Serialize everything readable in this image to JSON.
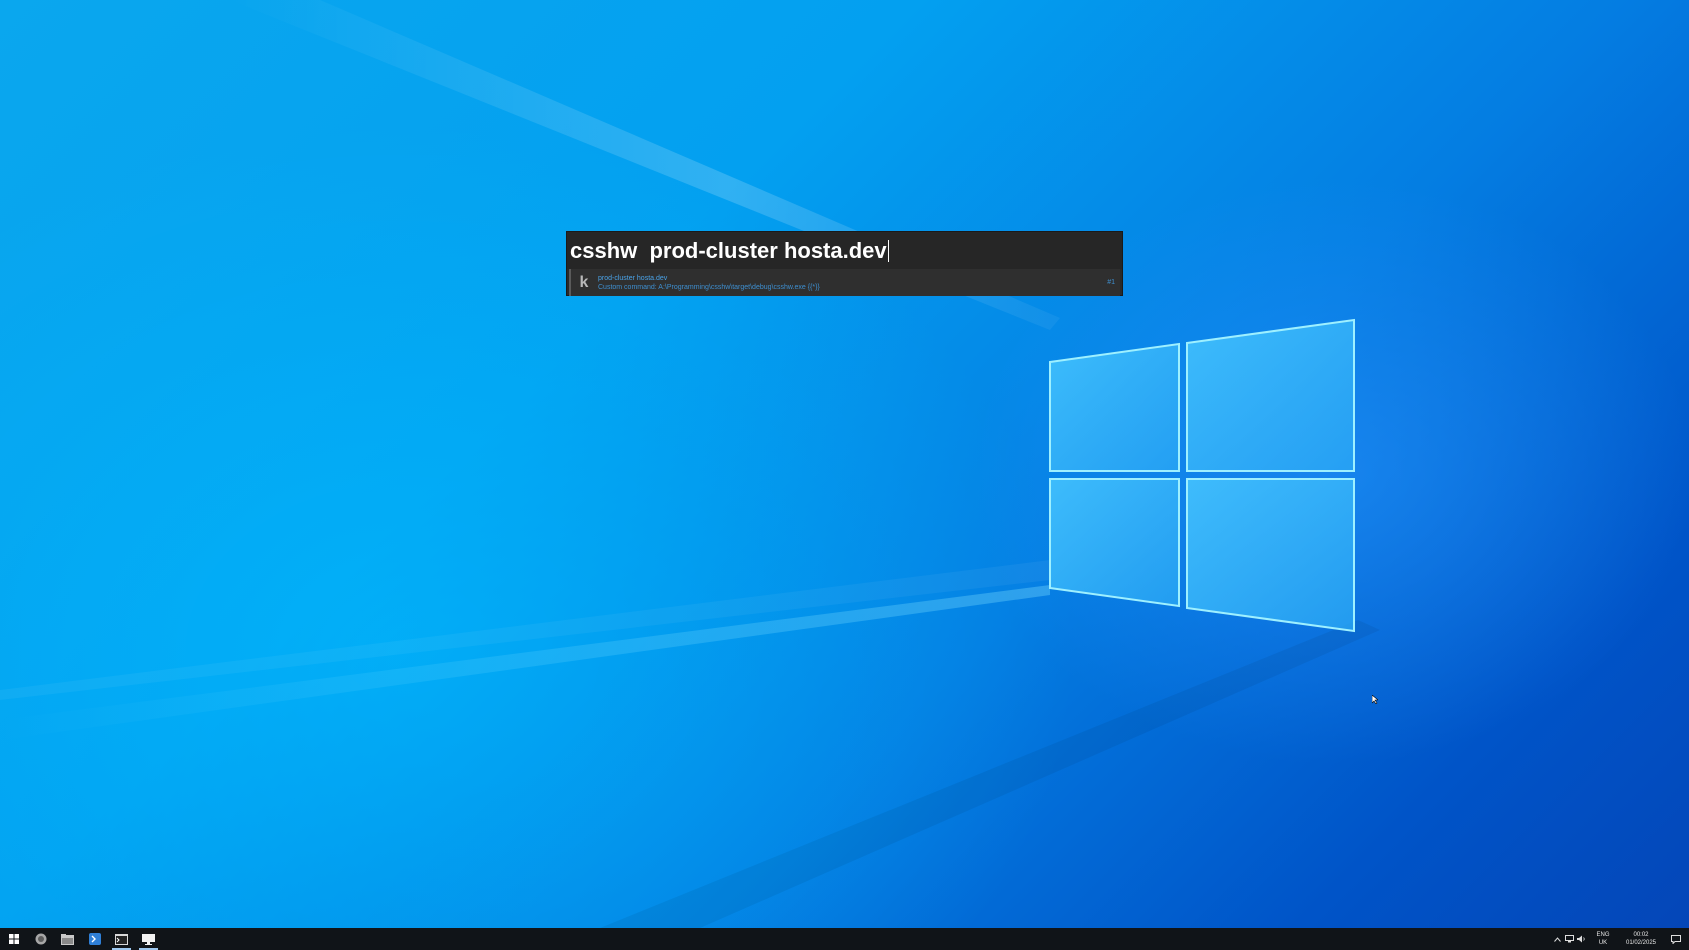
{
  "launcher": {
    "query": "csshw  prod-cluster hosta.dev",
    "result": {
      "icon": "k",
      "title": "prod-cluster hosta.dev",
      "subtitle": "Custom command: A:\\Programming\\csshw\\target\\debug\\csshw.exe {{*}}",
      "hotkey": "#1"
    }
  },
  "taskbar": {
    "apps": [
      {
        "icon": "windows-start-icon",
        "active": false
      },
      {
        "icon": "firefox-icon",
        "active": false
      },
      {
        "icon": "file-explorer-icon",
        "active": false
      },
      {
        "icon": "vscode-icon",
        "active": false
      },
      {
        "icon": "terminal-icon",
        "active": true
      },
      {
        "icon": "desktop-app-icon",
        "active": true
      }
    ],
    "tray": {
      "lang_top": "ENG",
      "lang_bottom": "UK",
      "time": "00:02",
      "date": "01/02/2025"
    }
  },
  "colors": {
    "launcher_bg": "#262626",
    "result_text": "#4aa3e8",
    "taskbar_bg": "#101418"
  }
}
